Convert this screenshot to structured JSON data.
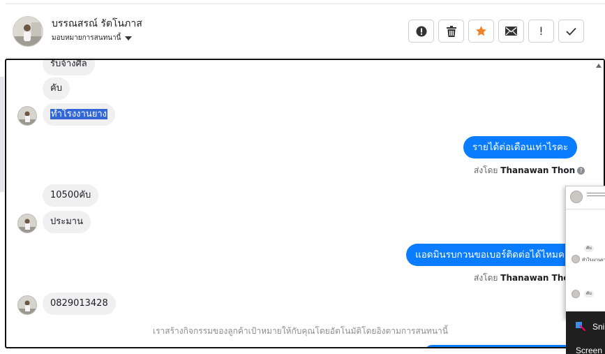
{
  "header": {
    "contact_name": "บรรณสรณ์ รัตโนภาส",
    "assign_label": "มอบหมายการสนทนานี้",
    "actions": [
      {
        "name": "report-icon",
        "glyph": "!"
      },
      {
        "name": "trash-icon",
        "glyph": ""
      },
      {
        "name": "star-icon",
        "glyph": "★"
      },
      {
        "name": "mail-icon",
        "glyph": ""
      },
      {
        "name": "exclamation-icon",
        "glyph": "!"
      },
      {
        "name": "check-icon",
        "glyph": "✓"
      }
    ]
  },
  "messages": {
    "m1": "รับจ้างศิล",
    "m2": "คับ",
    "m3": "ทำโรงงานยาง",
    "m4_out": "รายได้ต่อเดือนเท่าไรคะ",
    "m4_sender_prefix": "ส่งโดย",
    "m4_sender": "Thanawan Thon",
    "m5": "10500คับ",
    "m6": "ประมาน",
    "m7_out": "แอดมินรบกวนขอเบอร์ติดต่อได้ไหมคะ",
    "m7_sender_prefix": "ส่งโดย",
    "m7_sender": "Thanawan Thon",
    "m8": "0829013428"
  },
  "footnote": "เราสร้างกิจกรรมของลูกค้าเป้าหมายให้กับคุณโดยอัตโนมัติโดยอิงตามการสนทนานี้",
  "popup": {
    "bubble1": "คับ",
    "line1": "ทำโรงงานยาง",
    "bubble2": "คับ",
    "snip_label": "Sni",
    "screen_label": "Screen"
  },
  "colors": {
    "outgoing": "#0a7cff",
    "incoming": "#f0f0f0",
    "star": "#f0832a"
  }
}
